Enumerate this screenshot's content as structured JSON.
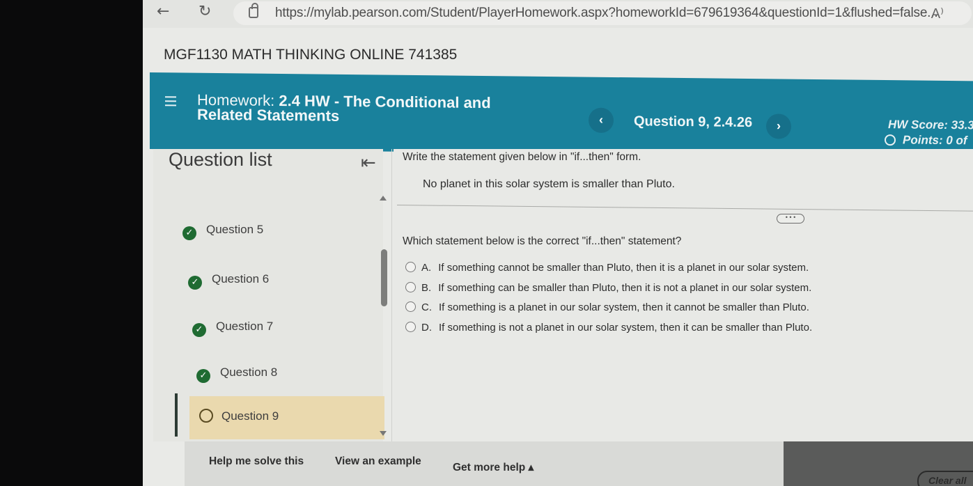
{
  "browser": {
    "back_icon": "←",
    "reload_icon": "↻",
    "url": "https://mylab.pearson.com/Student/PlayerHomework.aspx?homeworkId=679619364&questionId=1&flushed=false...",
    "read_aloud_icon": "A⁾"
  },
  "course": {
    "title": "MGF1130 MATH THINKING ONLINE 741385"
  },
  "header": {
    "homework_prefix": "Homework: ",
    "homework_title": "2.4 HW - The Conditional and Related Statements",
    "prev_icon": "‹",
    "question_label": "Question 9, 2.4.26",
    "next_icon": "›",
    "hw_score": "HW Score: 33.3",
    "points": "Points: 0 of"
  },
  "question_list": {
    "title": "Question list",
    "collapse_icon": "⇤",
    "items": [
      {
        "label": "Question 5",
        "status": "complete"
      },
      {
        "label": "Question 6",
        "status": "complete"
      },
      {
        "label": "Question 7",
        "status": "complete"
      },
      {
        "label": "Question 8",
        "status": "complete"
      },
      {
        "label": "Question 9",
        "status": "current"
      }
    ]
  },
  "question": {
    "instruction": "Write the statement given below in \"if...then\" form.",
    "statement": "No planet in this solar system is smaller than Pluto.",
    "more_label": "• • •",
    "prompt": "Which statement below is the correct \"if...then\" statement?",
    "options": [
      {
        "letter": "A.",
        "text": "If something cannot be smaller than Pluto, then it is a planet in our solar system."
      },
      {
        "letter": "B.",
        "text": "If something can be smaller than Pluto, then it is not a planet in our solar system."
      },
      {
        "letter": "C.",
        "text": "If something is a planet in our solar system, then it cannot be smaller than Pluto."
      },
      {
        "letter": "D.",
        "text": "If something is not a planet in our solar system, then it can be smaller than Pluto."
      }
    ]
  },
  "help": {
    "help_me_solve": "Help me solve this",
    "view_example": "View an example",
    "get_more_help": "Get more help ▴",
    "clear_all": "Clear all"
  },
  "colors": {
    "header_bg": "#19819c",
    "complete_check": "#1f6b32",
    "current_item_bg": "#ead9ae"
  }
}
